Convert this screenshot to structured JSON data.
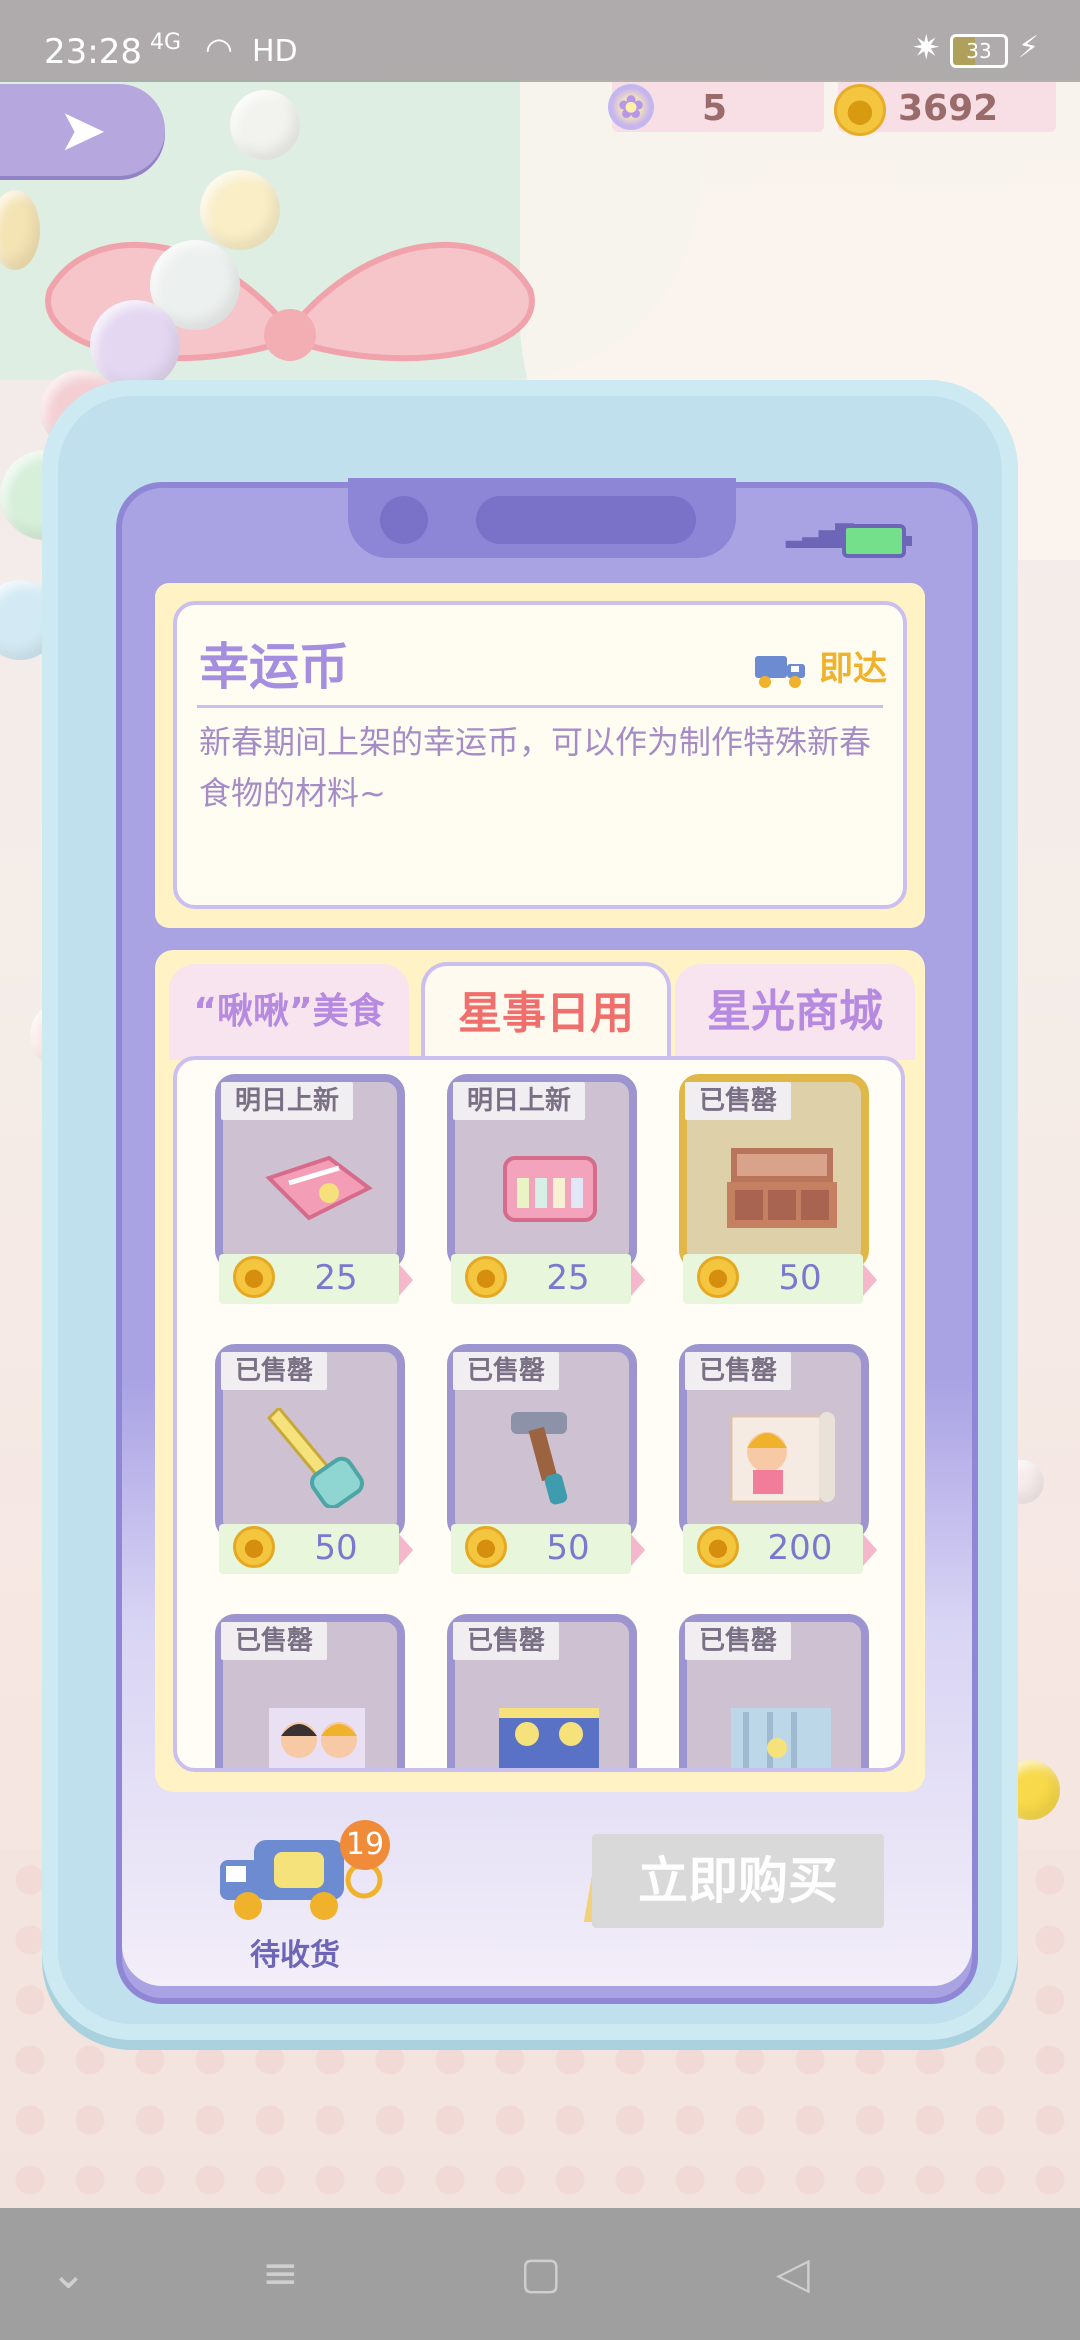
{
  "status_bar": {
    "time": "23:28",
    "signal": "4G",
    "network": "HD",
    "battery": "33"
  },
  "currency": {
    "stars": "5",
    "coins": "3692"
  },
  "item": {
    "title": "幸运币",
    "delivery": "即达",
    "description": "新春期间上架的幸运币，可以作为制作特殊新春食物的材料~"
  },
  "tabs": [
    {
      "label": "“啾啾”美食",
      "active": false
    },
    {
      "label": "星事日用",
      "active": true
    },
    {
      "label": "星光商城",
      "active": false
    }
  ],
  "products": [
    {
      "tag": "明日上新",
      "price": "25",
      "icon": "pink-mat-icon"
    },
    {
      "tag": "明日上新",
      "price": "25",
      "icon": "pink-case-icon"
    },
    {
      "tag": "已售罄",
      "price": "50",
      "icon": "cabinet-icon"
    },
    {
      "tag": "已售罄",
      "price": "50",
      "icon": "saw-icon"
    },
    {
      "tag": "已售罄",
      "price": "50",
      "icon": "hammer-icon"
    },
    {
      "tag": "已售罄",
      "price": "200",
      "icon": "poster-icon"
    },
    {
      "tag": "已售罄",
      "price": "",
      "icon": "poster-icon"
    },
    {
      "tag": "已售罄",
      "price": "",
      "icon": "poster-icon"
    },
    {
      "tag": "已售罄",
      "price": "",
      "icon": "poster-icon"
    }
  ],
  "bottom": {
    "pending_label": "待收货",
    "pending_count": "19",
    "buy_label": "立即购买"
  },
  "colors": {
    "accent_purple": "#a58ee0",
    "tab_active": "#ef6f6c",
    "gold": "#f0b22a"
  }
}
